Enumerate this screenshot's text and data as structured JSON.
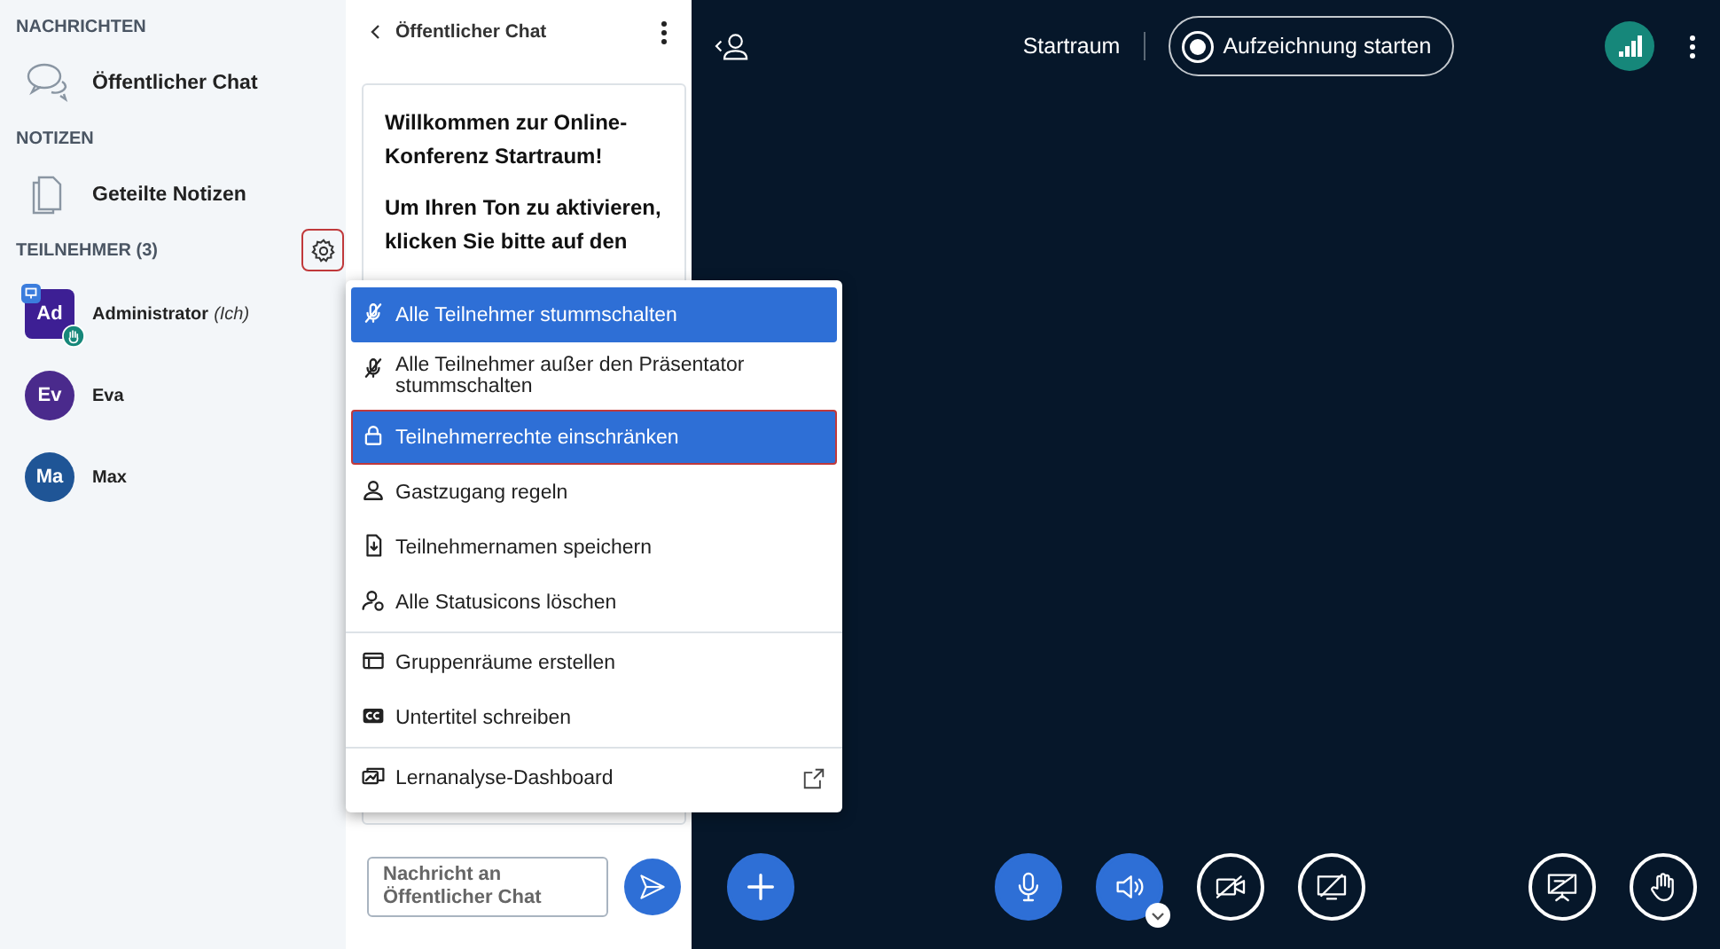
{
  "sidebar": {
    "sections": [
      {
        "heading": "NACHRICHTEN",
        "items": [
          {
            "label": "Öffentlicher Chat",
            "kind": "chat"
          }
        ]
      },
      {
        "heading": "NOTIZEN",
        "items": [
          {
            "label": "Geteilte Notizen",
            "kind": "notes"
          }
        ]
      }
    ],
    "participants": {
      "heading": "TEILNEHMER (3)",
      "settings_highlighted": true,
      "users": [
        {
          "initials": "Ad",
          "name": "Administrator",
          "suffix": "(Ich)",
          "color": "#3d1f94",
          "moderator": true,
          "presenter": true,
          "hand_raised": true
        },
        {
          "initials": "Ev",
          "name": "Eva",
          "color": "#4a2a8c",
          "moderator": false,
          "presenter": false,
          "hand_raised": false
        },
        {
          "initials": "Ma",
          "name": "Max",
          "color": "#1f5596",
          "moderator": false,
          "presenter": false,
          "hand_raised": false
        }
      ]
    }
  },
  "chat": {
    "title": "Öffentlicher Chat",
    "welcome": [
      "Willkommen zur Online-Konferenz **Startraum**!",
      "Um Ihren Ton zu aktivieren, klicken Sie bitte auf den"
    ],
    "input": {
      "placeholder": "Nachricht an Öffentlicher Chat"
    }
  },
  "menu": {
    "items": [
      {
        "label": "Alle Teilnehmer stummschalten",
        "kind": "mute",
        "selected": true,
        "highlighted": false,
        "divider_before": false,
        "external": false
      },
      {
        "label": "Alle Teilnehmer außer den Präsentator stummschalten",
        "kind": "mute",
        "selected": false,
        "highlighted": false,
        "divider_before": false,
        "external": false
      },
      {
        "label": "Teilnehmerrechte einschränken",
        "kind": "lock",
        "selected": true,
        "highlighted": true,
        "divider_before": false,
        "external": false
      },
      {
        "label": "Gastzugang regeln",
        "kind": "person",
        "selected": false,
        "highlighted": false,
        "divider_before": false,
        "external": false
      },
      {
        "label": "Teilnehmernamen speichern",
        "kind": "file",
        "selected": false,
        "highlighted": false,
        "divider_before": false,
        "external": false
      },
      {
        "label": "Alle Statusicons löschen",
        "kind": "person-clear",
        "selected": false,
        "highlighted": false,
        "divider_before": false,
        "external": false
      },
      {
        "label": "Gruppenräume erstellen",
        "kind": "rooms",
        "selected": false,
        "highlighted": false,
        "divider_before": true,
        "external": false
      },
      {
        "label": "Untertitel schreiben",
        "kind": "cc",
        "selected": false,
        "highlighted": false,
        "divider_before": false,
        "external": false
      },
      {
        "label": "Lernanalyse-Dashboard",
        "kind": "dashboard",
        "selected": false,
        "highlighted": false,
        "divider_before": true,
        "external": true
      }
    ]
  },
  "topbar": {
    "room": "Startraum",
    "record_button": "Aufzeichnung starten"
  },
  "controls": [
    {
      "kind": "plus",
      "active": true
    },
    {
      "kind": "mic",
      "active": true
    },
    {
      "kind": "speaker",
      "active": true
    },
    {
      "kind": "camera",
      "active": false
    },
    {
      "kind": "screen",
      "active": false
    },
    {
      "kind": "presentation",
      "active": false
    },
    {
      "kind": "hand",
      "active": false
    }
  ]
}
